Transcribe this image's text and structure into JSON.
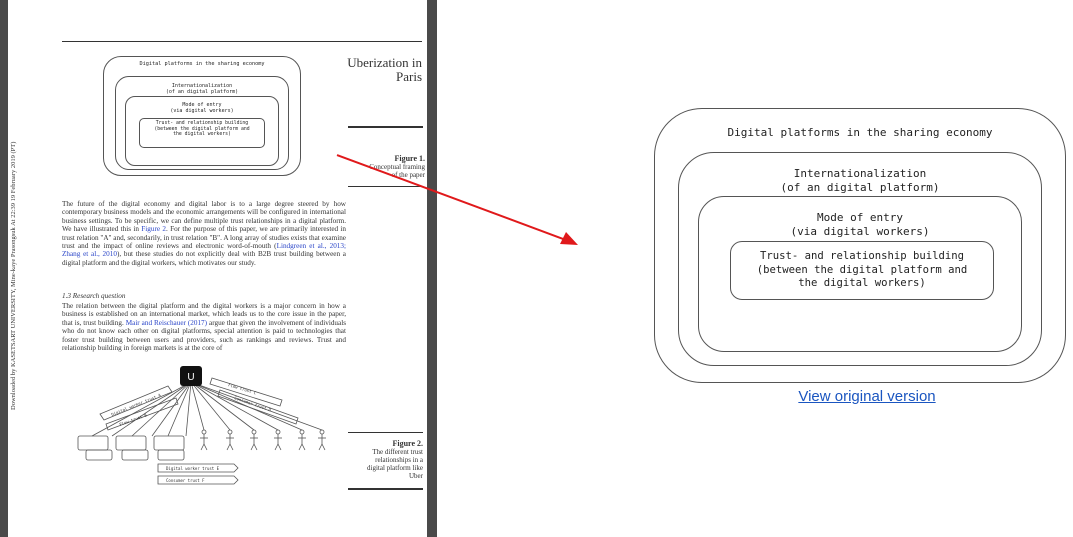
{
  "page": {
    "running_head": [
      "Uberization in",
      "Paris"
    ],
    "side_note": "Downloaded by KASETSART UNIVERSITY, Mine-kaye Prasongsuk At 22:39 19 February 2019 (PT)",
    "figure1": {
      "label": "Figure 1.",
      "caption_lines": [
        "Conceptual framing",
        "of the paper"
      ]
    },
    "paragraph1_a": "The future of the digital economy and digital labor is to a large degree steered by how contemporary business models and the economic arrangements will be configured in international business settings. To be specific, we can define multiple trust relationships in a digital platform. We have illustrated this in ",
    "paragraph1_link1": "Figure 2",
    "paragraph1_b": ". For the purpose of this paper, we are primarily interested in trust relation \"A\" and, secondarily, in trust relation \"B\". A long array of studies exists that examine trust and the impact of online reviews and electronic word-of-mouth (",
    "paragraph1_link2": "Lindgreen et al., 2013; Zhang et al., 2010",
    "paragraph1_c": "), but these studies do not explicitly deal with B2B trust building between a digital platform and the digital workers, which motivates our study.",
    "section_heading": "1.3 Research question",
    "paragraph2_a": "The relation between the digital platform and the digital workers is a major concern in how a business is established on an international market, which leads us to the core issue in the paper, that is, trust building. ",
    "paragraph2_link": "Mair and Reischauer (2017)",
    "paragraph2_b": " argue that given the involvement of individuals who do not know each other on digital platforms, special attention is paid to technologies that foster trust building between users and providers, such as rankings and reviews. Trust and relationship building in foreign markets is at the core of",
    "figure2": {
      "label": "Figure 2.",
      "caption_lines": [
        "The different trust",
        "relationships in a",
        "digital platform like",
        "Uber"
      ]
    },
    "figure2_diagram": {
      "hub_label": "U",
      "arrow_labels": [
        "Digital worker trust A",
        "Flow trust B",
        "Flow trust C",
        "Consumer trust D",
        "Digital worker trust E",
        "Consumer trust F"
      ]
    }
  },
  "mini_figure": {
    "outer": "Digital platforms in the sharing economy",
    "level2": "Internationalization\n(of an digital platform)",
    "level3": "Mode of entry\n(via digital workers)",
    "level4": "Trust- and relationship building\n(between the digital platform and\nthe digital workers)"
  },
  "diagram": {
    "outer": "Digital platforms in the sharing economy",
    "level2": "Internationalization\n(of an digital platform)",
    "level3": "Mode of entry\n(via digital workers)",
    "level4": "Trust- and relationship building\n(between the digital platform and\nthe digital workers)"
  },
  "view_link": "View original version",
  "colors": {
    "arrow": "#e0191b",
    "link": "#1a55c0",
    "frame": "#4a4a4a"
  }
}
